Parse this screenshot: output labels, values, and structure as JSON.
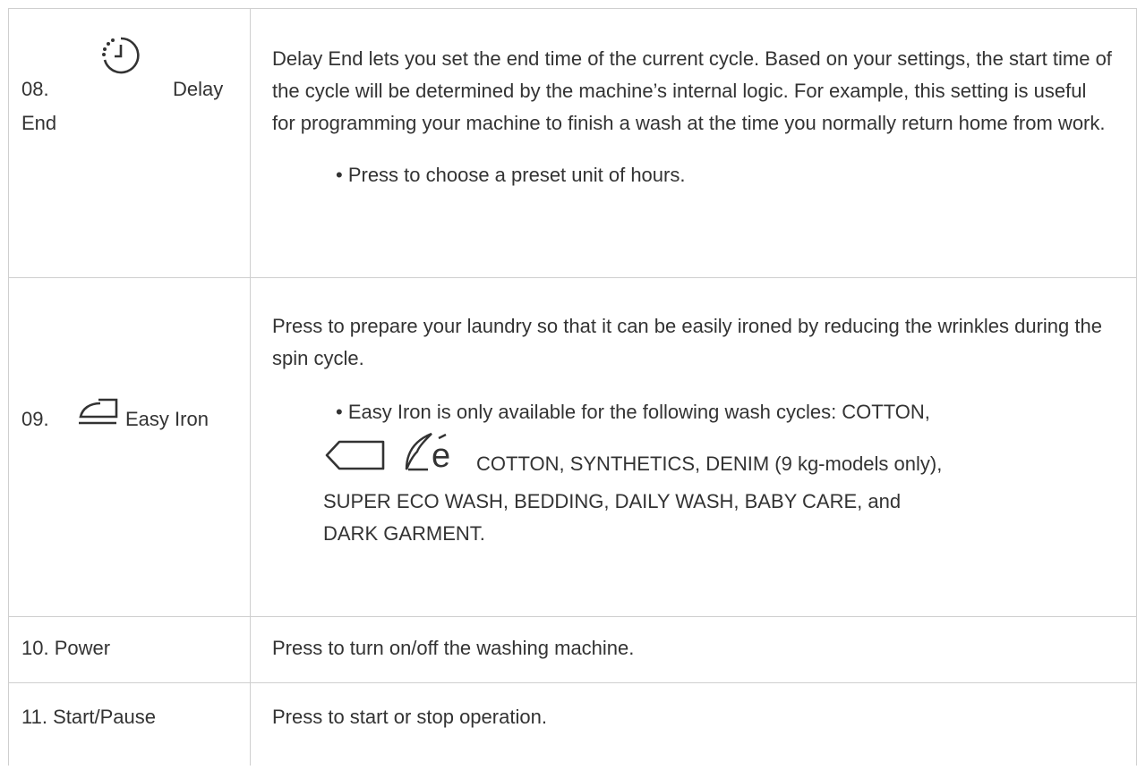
{
  "rows": [
    {
      "number": "08.",
      "label_word1": "Delay",
      "label_word2": "End",
      "icon": "delay-end-clock-icon",
      "paragraph": "Delay End lets you set the end time of the current cycle. Based on your settings, the start time of the cycle will be determined by the machine’s internal logic. For example, this setting is useful for programming your machine to finish a wash at the time you normally return home from work.",
      "bullet": "• Press to choose a preset unit of hours."
    },
    {
      "number": "09.",
      "label_word": "Easy Iron",
      "icon": "iron-icon",
      "paragraph": "Press to prepare your laundry so that it can be easily ironed by reducing the wrinkles during the spin cycle.",
      "bullet_line1": "• Easy Iron is only available for the following wash cycles: COTTON,",
      "bullet_line2": "COTTON, SYNTHETICS, DENIM (9 kg-models only),",
      "bullet_line3": "SUPER ECO WASH, BEDDING, DAILY WASH, BABY CARE, and",
      "bullet_line4": "DARK GARMENT.",
      "inline_icons": [
        "rounded-tag-icon",
        "eco-e-icon"
      ]
    },
    {
      "label": "10. Power",
      "description": "Press to turn on/off the washing machine."
    },
    {
      "label": "11. Start/Pause",
      "description": "Press to start or stop operation."
    }
  ]
}
